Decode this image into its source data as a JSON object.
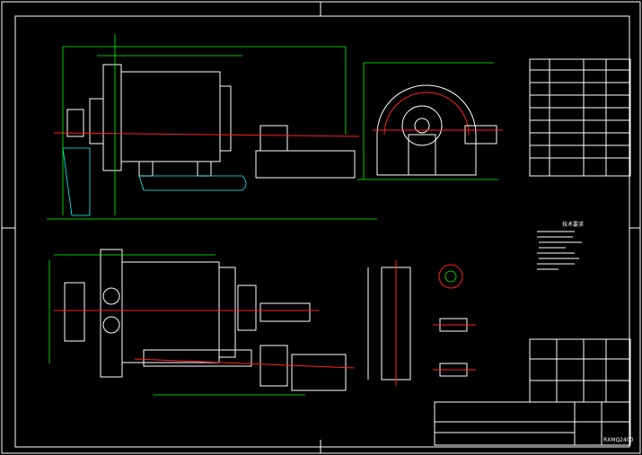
{
  "drawing": {
    "background": "#000000",
    "colors": {
      "outline": "#ffffff",
      "dimension": "#00ff00",
      "centerline": "#ff2020",
      "hatch": "#00ffff"
    },
    "tech_requirements_title": "技术要求",
    "title_block": {
      "drawing_number": "RXMQ2400"
    }
  }
}
